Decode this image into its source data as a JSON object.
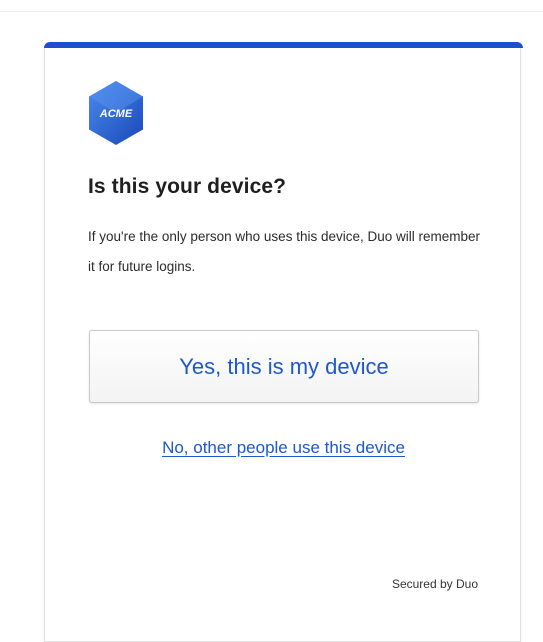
{
  "logo": {
    "icon": "acme-hexagon-logo",
    "text": "ACME",
    "color_light": "#3f7fe6",
    "color_dark": "#1c4fc4"
  },
  "prompt": {
    "title": "Is this your device?",
    "description": "If you're the only person who uses this device, Duo will remember it for future logins."
  },
  "actions": {
    "yes_label": "Yes, this is my device",
    "no_label": "No, other people use this device"
  },
  "footer": {
    "secured_text": "Secured by Duo"
  },
  "colors": {
    "accent": "#1b4fcf",
    "link": "#1d58cc"
  }
}
